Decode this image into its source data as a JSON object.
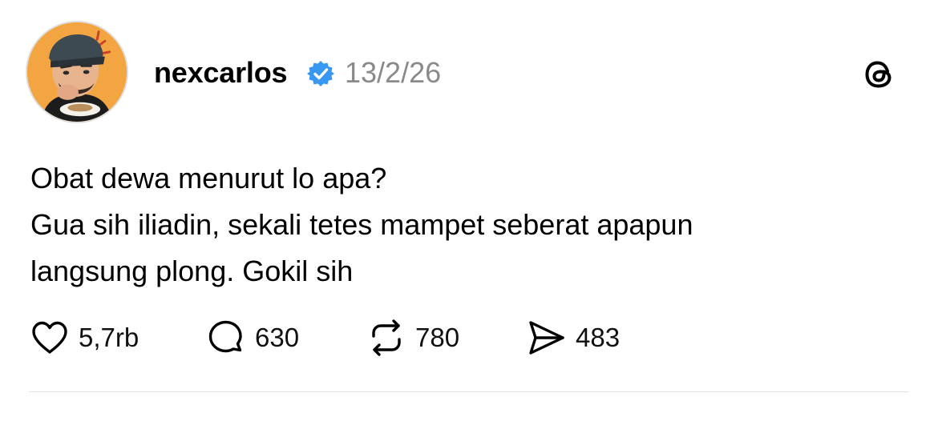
{
  "post": {
    "author": {
      "username": "nexcarlos",
      "verified": true,
      "avatar": "avatar-photo"
    },
    "date": "13/2/26",
    "content": [
      "Obat dewa menurut lo apa?",
      "Gua sih iliadin, sekali tetes mampet seberat apapun",
      "langsung plong. Gokil sih"
    ],
    "actions": {
      "like": {
        "icon": "heart-icon",
        "count": "5,7rb"
      },
      "comment": {
        "icon": "comment-bubble-icon",
        "count": "630"
      },
      "repost": {
        "icon": "repost-icon",
        "count": "780"
      },
      "share": {
        "icon": "send-icon",
        "count": "483"
      }
    }
  },
  "app": {
    "logo": "threads-logo-icon"
  },
  "colors": {
    "verified_badge": "#3897f0",
    "date_text": "#8a8a8a",
    "avatar_background": "#f2a541",
    "divider": "#e3e3e3"
  }
}
